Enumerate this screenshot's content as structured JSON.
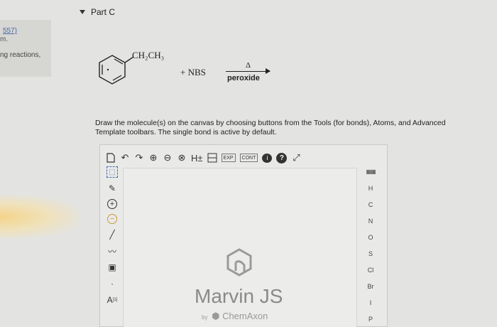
{
  "sidebar": {
    "ref": "557)",
    "em": "m.",
    "reactions": "ng reactions,"
  },
  "part": {
    "title": "Part C"
  },
  "reaction": {
    "substituent": "CH₂CH₃",
    "plus_reagent": "+ NBS",
    "arrow_above": "Δ",
    "arrow_below": "peroxide"
  },
  "instructions": "Draw the molecule(s) on the canvas by choosing buttons from the Tools (for bonds), Atoms, and Advanced Template toolbars. The single bond is active by default.",
  "toolbar": {
    "hydrogen": "H±",
    "exp": "EXP",
    "cont": "CONT",
    "help": "?",
    "info": "i"
  },
  "left_tools": {
    "atom_label": "A",
    "atom_index": "[1]"
  },
  "atoms": [
    "H",
    "C",
    "N",
    "O",
    "S",
    "Cl",
    "Br",
    "I",
    "P"
  ],
  "branding": {
    "name": "Marvin JS",
    "by": "by",
    "company": "ChemAxon"
  }
}
